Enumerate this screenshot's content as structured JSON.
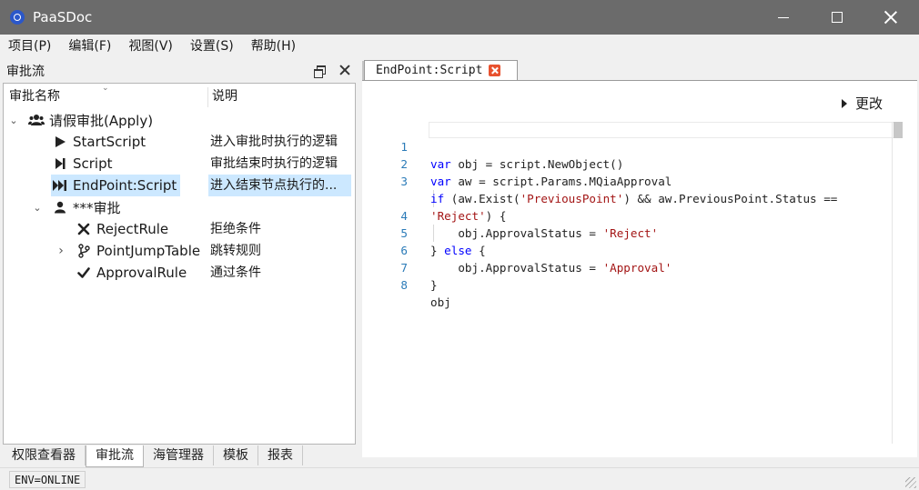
{
  "window": {
    "title": "PaaSDoc"
  },
  "menu": [
    "项目(P)",
    "编辑(F)",
    "视图(V)",
    "设置(S)",
    "帮助(H)"
  ],
  "left_panel": {
    "title": "审批流",
    "columns": [
      "审批名称",
      "说明"
    ],
    "tree": [
      {
        "label": "请假审批(Apply)",
        "desc": "",
        "icon": "users-icon",
        "expander": "expanded"
      },
      {
        "label": "StartScript",
        "desc": "进入审批时执行的逻辑",
        "icon": "play-icon"
      },
      {
        "label": "Script",
        "desc": "审批结束时执行的逻辑",
        "icon": "step-end-icon"
      },
      {
        "label": "EndPoint:Script",
        "desc": "进入结束节点执行的...",
        "icon": "fast-forward-end-icon",
        "selected": true
      },
      {
        "label": "***审批",
        "desc": "",
        "icon": "user-icon",
        "expander": "expanded"
      },
      {
        "label": "RejectRule",
        "desc": "拒绝条件",
        "icon": "x-icon"
      },
      {
        "label": "PointJumpTable",
        "desc": "跳转规则",
        "icon": "branch-icon",
        "expander": "collapsed"
      },
      {
        "label": "ApprovalRule",
        "desc": "通过条件",
        "icon": "check-icon"
      }
    ],
    "bottom_tabs": [
      "权限查看器",
      "审批流",
      "海管理器",
      "模板",
      "报表"
    ],
    "active_bottom_tab": "审批流"
  },
  "editor": {
    "tab_label": "EndPoint:Script",
    "change_label": "更改",
    "lines": [
      {
        "num": "1",
        "text": "var obj = script.NewObject()"
      },
      {
        "num": "2",
        "text": "var aw = script.Params.MQiaApproval"
      },
      {
        "num": "3",
        "text": "if (aw.Exist('PreviousPoint') && aw.PreviousPoint.Status =="
      },
      {
        "num": "",
        "text": "'Reject') {"
      },
      {
        "num": "4",
        "text": "    obj.ApprovalStatus = 'Reject'"
      },
      {
        "num": "5",
        "text": "} else {"
      },
      {
        "num": "6",
        "text": "    obj.ApprovalStatus = 'Approval'"
      },
      {
        "num": "7",
        "text": "}"
      },
      {
        "num": "8",
        "text": "obj"
      }
    ]
  },
  "status": {
    "env": "ENV=ONLINE"
  }
}
